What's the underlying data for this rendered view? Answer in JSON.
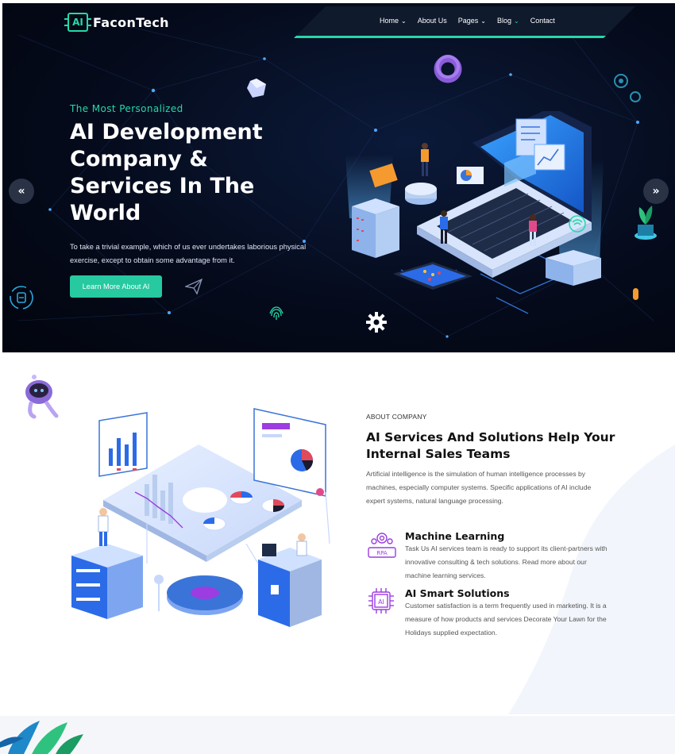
{
  "header": {
    "logo_mark": "AI",
    "logo_text": "FaconTech",
    "nav": [
      {
        "label": "Home",
        "chev": "⌄"
      },
      {
        "label": "About Us",
        "chev": ""
      },
      {
        "label": "Pages",
        "chev": "⌄"
      },
      {
        "label": "Blog",
        "chev": "⌄"
      },
      {
        "label": "Contact",
        "chev": ""
      }
    ]
  },
  "hero": {
    "subtitle": "The Most Personalized",
    "title": "AI Development Company & Services In The World",
    "description": "To take a trivial example, which of us ever undertakes laborious physical exercise, except to obtain some advantage from it.",
    "button_label": "Learn More About AI",
    "prev_label": "«",
    "next_label": "»"
  },
  "about": {
    "tag": "ABOUT COMPANY",
    "title": "AI Services And Solutions Help Your Internal Sales Teams",
    "description": "Artificial intelligence is the simulation of human intelligence processes by machines, especially computer systems. Specific applications of AI include expert systems, natural language processing.",
    "features": [
      {
        "title": "Machine Learning",
        "description": "Task Us AI services team is ready to support its client-partners with innovative consulting & tech solutions. Read more about our machine learning services.",
        "icon": "gear-rpa-icon",
        "icon_text": "RPA"
      },
      {
        "title": "AI Smart Solutions",
        "description": "Customer satisfaction is a term frequently used in marketing. It is a measure of how products and services Decorate Your Lawn for the Holidays supplied expectation.",
        "icon": "ai-chip-icon",
        "icon_text": "AI"
      }
    ]
  },
  "colors": {
    "accent": "#26d9a8",
    "hero_bg": "#050b1c",
    "purple": "#9b3de0",
    "blue": "#2b6be8"
  }
}
